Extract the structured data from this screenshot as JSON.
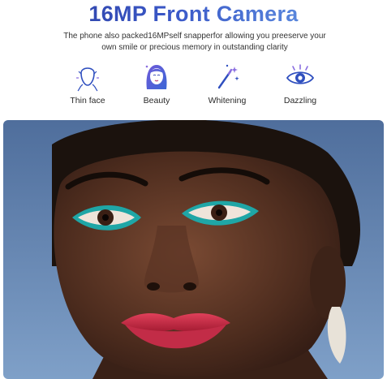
{
  "header": {
    "title": "16MP Front Camera",
    "description": "The phone also packed16MPself snapperfor allowing you preeserve  your own smile or precious memory in outstanding  clarity"
  },
  "features": [
    {
      "label": "Thin face",
      "icon": "face-outline-icon"
    },
    {
      "label": "Beauty",
      "icon": "beauty-woman-icon"
    },
    {
      "label": "Whitening",
      "icon": "magic-wand-sparkle-icon"
    },
    {
      "label": "Dazzling",
      "icon": "eye-icon"
    }
  ],
  "photo": {
    "subject": "close-up portrait of a woman with teal eyeliner and red lips against a blue sky"
  },
  "colors": {
    "title_gradient_start": "#2a3a9a",
    "title_gradient_end": "#6ea7ea",
    "icon_primary": "#2f4fbf",
    "icon_accent": "#8a6ee0"
  }
}
